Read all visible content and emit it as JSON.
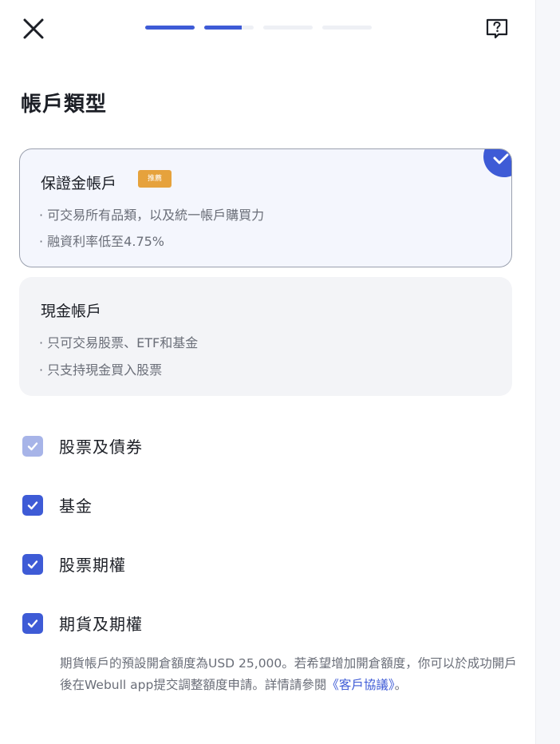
{
  "header": {
    "close_icon": "close-icon",
    "help_icon": "help-question-icon",
    "progress": {
      "total_steps": 4,
      "completed_fraction": 0.375
    }
  },
  "page_title": "帳戶類型",
  "account_options": [
    {
      "title": "保證金帳戶",
      "badge": "推薦",
      "bullets": [
        "· 可交易所有品類，以及統一帳戶購買力",
        "· 融資利率低至4.75%"
      ],
      "selected": true
    },
    {
      "title": "現金帳戶",
      "bullets": [
        "· 只可交易股票、ETF和基金",
        "· 只支持現金買入股票"
      ],
      "selected": false
    }
  ],
  "products": [
    {
      "label": "股票及債券",
      "checked": true,
      "disabled": true
    },
    {
      "label": "基金",
      "checked": true,
      "disabled": false
    },
    {
      "label": "股票期權",
      "checked": true,
      "disabled": false
    },
    {
      "label": "期貨及期權",
      "checked": true,
      "disabled": false
    }
  ],
  "futures_note": {
    "text_before": "期貨帳戶的預設開倉額度為USD 25,000。若希望增加開倉額度，你可以於成功開戶後在Webull app提交調整額度申請。詳情請參閱",
    "link": "《客戶協議》",
    "text_after": "。"
  },
  "colors": {
    "accent": "#3e5bd6",
    "accent_disabled": "#a7b4e8",
    "badge": "#e6a23c",
    "selected_card_bg": "#f4f6fd",
    "card_bg": "#f3f4f7"
  }
}
